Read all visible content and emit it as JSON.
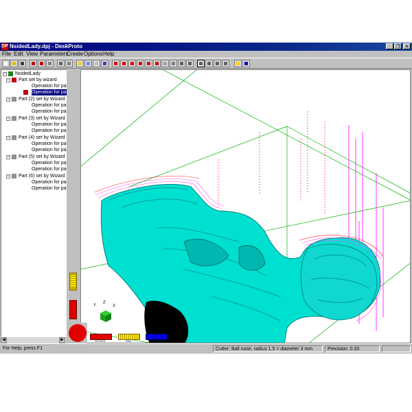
{
  "window": {
    "title": "NsidedLady.dpj - DeskProto",
    "icon_text": "DP",
    "controls": {
      "minimize": "_",
      "maximize": "❐",
      "close": "✕"
    }
  },
  "menu": [
    "File",
    "Edit",
    "View",
    "Parameters",
    "Create",
    "Options",
    "Help"
  ],
  "toolbar": {
    "icons": [
      "new-icon",
      "open-icon",
      "save-icon",
      "part-icon",
      "delete-icon",
      "cut-icon",
      "print-icon",
      "preview-icon",
      "layers-icon",
      "grid-icon",
      "table-icon",
      "eye-icon",
      "cube-red-icon",
      "cube-solid-icon",
      "cube-wire-icon",
      "cube-top-icon",
      "cube-side-icon",
      "cube-iso-icon",
      "sphere-icon",
      "rotate-icon",
      "fit-icon",
      "view-icon",
      "pan-icon",
      "move-icon",
      "zoom-in-icon",
      "zoom-icon",
      "context-help-icon",
      "help-icon"
    ]
  },
  "tree": {
    "root": "NsidedLady",
    "parts": [
      {
        "label": "Part set by wizard",
        "ops": [
          "Operation for part",
          "Operation for part"
        ]
      },
      {
        "label": "Part (2) set by Wizard",
        "ops": [
          "Operation for part",
          "Operation for part"
        ]
      },
      {
        "label": "Part (3) set by Wizard",
        "ops": [
          "Operation for part",
          "Operation for part"
        ]
      },
      {
        "label": "Part (4) set by Wizard",
        "ops": [
          "Operation for part",
          "Operation for part"
        ]
      },
      {
        "label": "Part (5) set by Wizard",
        "ops": [
          "Operation for part",
          "Operation for part"
        ]
      },
      {
        "label": "Part (6) set by Wizard",
        "ops": [
          "Operation for part",
          "Operation for part"
        ]
      }
    ]
  },
  "viewport": {
    "axis_labels": {
      "x": "X",
      "y": "Y",
      "z": "Z"
    },
    "controls": {
      "rotate": "ROTATE",
      "pan": "PAN",
      "zoom": "ZOOM"
    },
    "model_color": "#00e0d0",
    "toolpath_colors": [
      "#ff00ff",
      "#ff0000",
      "#00c000"
    ]
  },
  "status": {
    "help": "For Help, press F1",
    "cutter": "Cutter: Ball nose, radius 1.5 = diameter 3 mm",
    "precision": "Precision: 0.33"
  }
}
